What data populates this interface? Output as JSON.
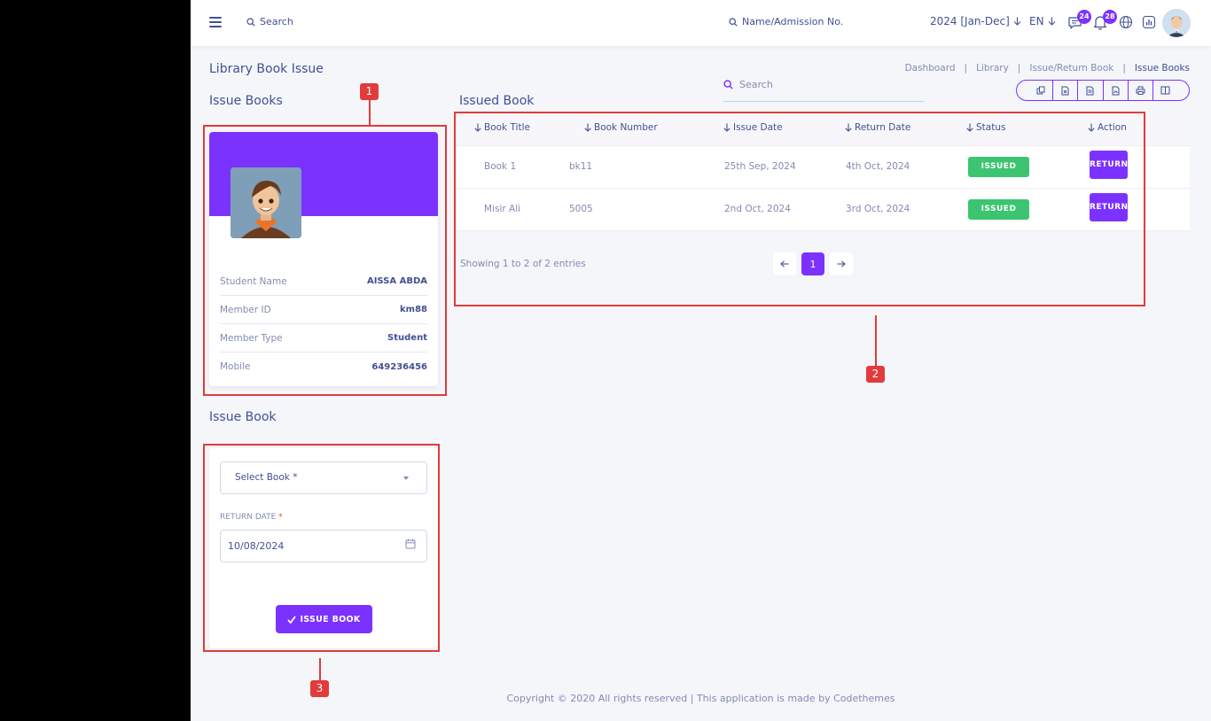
{
  "topbar": {
    "search_label": "Search",
    "name_search_label": "Name/Admission No.",
    "session": "2024 [Jan-Dec]",
    "language": "EN",
    "messages_count": "24",
    "notifications_count": "28"
  },
  "page": {
    "title": "Library Book Issue",
    "breadcrumb": [
      "Dashboard",
      "Library",
      "Issue/Return Book",
      "Issue Books"
    ],
    "breadcrumb_sep": "|"
  },
  "issue_books": {
    "title": "Issue Books",
    "student": {
      "rows": [
        {
          "label": "Student Name",
          "value": "AISSA ABDA"
        },
        {
          "label": "Member ID",
          "value": "km88"
        },
        {
          "label": "Member Type",
          "value": "Student"
        },
        {
          "label": "Mobile",
          "value": "649236456"
        }
      ]
    }
  },
  "issue_form": {
    "title": "Issue Book",
    "select_placeholder": "Select Book *",
    "return_date_label": "RETURN DATE",
    "required_mark": "*",
    "return_date_value": "10/08/2024",
    "submit_label": "ISSUE BOOK"
  },
  "issued": {
    "title": "Issued Book",
    "search_placeholder": "Search",
    "columns": [
      "Book Title",
      "Book Number",
      "Issue Date",
      "Return Date",
      "Status",
      "Action"
    ],
    "rows": [
      {
        "title": "Book 1",
        "number": "bk11",
        "issue_date": "25th Sep, 2024",
        "return_date": "4th Oct, 2024",
        "status": "ISSUED",
        "action": "RETURN"
      },
      {
        "title": "Misir Ali",
        "number": "5005",
        "issue_date": "2nd Oct, 2024",
        "return_date": "3rd Oct, 2024",
        "status": "ISSUED",
        "action": "RETURN"
      }
    ],
    "showing": "Showing 1 to 2 of 2 entries",
    "current_page": "1"
  },
  "annotations": [
    "1",
    "2",
    "3"
  ],
  "footer": "Copyright © 2020 All rights reserved | This application is made by Codethemes",
  "colors": {
    "accent": "#7c32ff",
    "success": "#3cc471",
    "annotation": "#e23b3b",
    "text": "#415094"
  }
}
